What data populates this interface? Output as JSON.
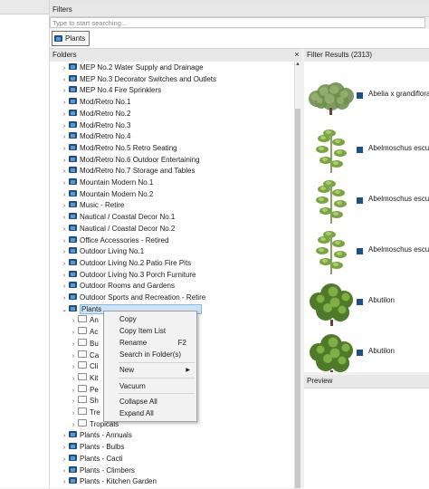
{
  "filters": {
    "header": "Filters",
    "search_placeholder": "Type to start searching...",
    "chip_label": "Plants"
  },
  "folders": {
    "header": "Folders",
    "close": "×",
    "items": [
      {
        "label": "MEP No.2 Water Supply and Drainage",
        "expanded": false
      },
      {
        "label": "MEP No.3 Decorator Switches and Outlets",
        "expanded": false
      },
      {
        "label": "MEP No.4 Fire Sprinklers",
        "expanded": false
      },
      {
        "label": "Mod/Retro No.1",
        "expanded": false
      },
      {
        "label": "Mod/Retro No.2",
        "expanded": false
      },
      {
        "label": "Mod/Retro No.3",
        "expanded": false
      },
      {
        "label": "Mod/Retro No.4",
        "expanded": false
      },
      {
        "label": "Mod/Retro No.5 Retro Seating",
        "expanded": false
      },
      {
        "label": "Mod/Retro No.6 Outdoor Entertaining",
        "expanded": false
      },
      {
        "label": "Mod/Retro No.7 Storage and Tables",
        "expanded": false
      },
      {
        "label": "Mountain Modern No.1",
        "expanded": false
      },
      {
        "label": "Mountain Modern No.2",
        "expanded": false
      },
      {
        "label": "Music - Retire",
        "expanded": false
      },
      {
        "label": "Nautical / Coastal Decor No.1",
        "expanded": false
      },
      {
        "label": "Nautical / Coastal Decor No.2",
        "expanded": false
      },
      {
        "label": "Office Accessories - Retired",
        "expanded": false
      },
      {
        "label": "Outdoor Living No.1",
        "expanded": false
      },
      {
        "label": "Outdoor Living No.2 Patio Fire Pits",
        "expanded": false
      },
      {
        "label": "Outdoor Living No.3 Porch Furniture",
        "expanded": false
      },
      {
        "label": "Outdoor Rooms and Gardens",
        "expanded": false
      },
      {
        "label": "Outdoor Sports and Recreation - Retire",
        "expanded": false
      },
      {
        "label": "Plants",
        "expanded": true,
        "selected": true
      },
      {
        "label": "An",
        "child": true
      },
      {
        "label": "Ac",
        "child": true
      },
      {
        "label": "Bu",
        "child": true
      },
      {
        "label": "Ca",
        "child": true
      },
      {
        "label": "Cli",
        "child": true
      },
      {
        "label": "Kit",
        "child": true
      },
      {
        "label": "Pe",
        "child": true
      },
      {
        "label": "Sh",
        "child": true
      },
      {
        "label": "Tre",
        "child": true
      },
      {
        "label": "Tropicals",
        "child": true
      },
      {
        "label": "Plants - Annuals",
        "expanded": false
      },
      {
        "label": "Plants - Bulbs",
        "expanded": false
      },
      {
        "label": "Plants - Cacti",
        "expanded": false
      },
      {
        "label": "Plants - Climbers",
        "expanded": false
      },
      {
        "label": "Plants - Kitchen Garden",
        "expanded": false
      }
    ]
  },
  "context_menu": {
    "items": [
      {
        "label": "Copy"
      },
      {
        "label": "Copy Item List"
      },
      {
        "label": "Rename",
        "shortcut": "F2"
      },
      {
        "label": "Search in Folder(s)"
      },
      {
        "label": "New",
        "submenu": "▶"
      },
      {
        "label": "Vacuum"
      },
      {
        "label": "Collapse All"
      },
      {
        "label": "Expand All"
      }
    ]
  },
  "results": {
    "header": "Filter Results (2313)",
    "items": [
      {
        "name": "Abelia x grandiflora",
        "thumb": "shrub"
      },
      {
        "name": "Abelmoschus esculentus",
        "thumb": "stalk"
      },
      {
        "name": "Abelmoschus esculentus",
        "thumb": "stalk"
      },
      {
        "name": "Abelmoschus esculentus",
        "thumb": "stalk"
      },
      {
        "name": "Abutilon",
        "thumb": "bush"
      },
      {
        "name": "Abutilon",
        "thumb": "bush"
      }
    ]
  },
  "preview": {
    "header": "Preview"
  },
  "icons": {
    "folder": "folder-icon",
    "item": "plant-item-icon",
    "expand": "chevron-right-icon",
    "collapse": "chevron-down-icon"
  },
  "colors": {
    "folder_dark": "#1d4f82",
    "folder_light": "#5c9ad1",
    "selection": "#cce4f7",
    "selection_border": "#84b9e6"
  }
}
